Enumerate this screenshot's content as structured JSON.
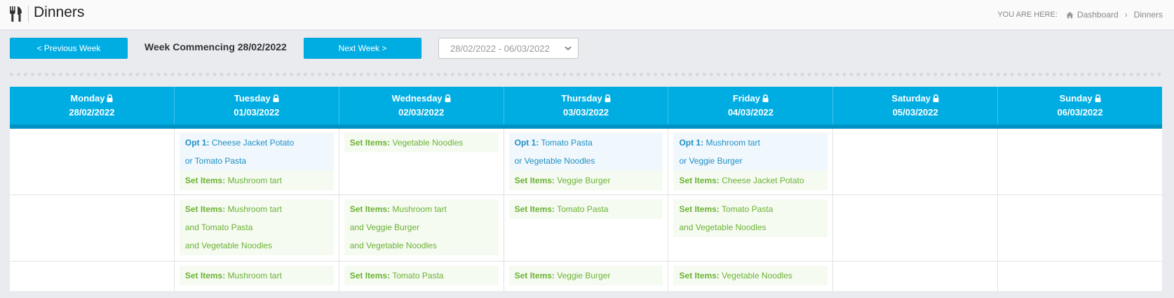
{
  "page": {
    "title": "Dinners",
    "breadcrumb": {
      "prefix": "YOU ARE HERE:",
      "items": [
        "Dashboard",
        "Dinners"
      ]
    }
  },
  "toolbar": {
    "prev_label": "< Previous Week",
    "next_label": "Next Week >",
    "week_label": "Week Commencing 28/02/2022",
    "range_value": "28/02/2022 - 06/03/2022"
  },
  "calendar": {
    "days": [
      {
        "name": "Monday",
        "date": "28/02/2022"
      },
      {
        "name": "Tuesday",
        "date": "01/03/2022"
      },
      {
        "name": "Wednesday",
        "date": "02/03/2022"
      },
      {
        "name": "Thursday",
        "date": "03/03/2022"
      },
      {
        "name": "Friday",
        "date": "04/03/2022"
      },
      {
        "name": "Saturday",
        "date": "05/03/2022"
      },
      {
        "name": "Sunday",
        "date": "06/03/2022"
      }
    ],
    "labels": {
      "option": "Opt 1:",
      "set": "Set Items:"
    },
    "rows": [
      [
        {},
        {
          "option": [
            "Cheese Jacket Potato",
            "or Tomato Pasta"
          ],
          "set": [
            "Mushroom tart"
          ]
        },
        {
          "set": [
            "Vegetable Noodles"
          ]
        },
        {
          "option": [
            "Tomato Pasta",
            "or Vegetable Noodles"
          ],
          "set": [
            "Veggie Burger"
          ]
        },
        {
          "option": [
            "Mushroom tart",
            "or Veggie Burger"
          ],
          "set": [
            "Cheese Jacket Potato"
          ]
        },
        {},
        {}
      ],
      [
        {},
        {
          "set": [
            "Mushroom tart",
            "and Tomato Pasta",
            "and Vegetable Noodles"
          ]
        },
        {
          "set": [
            "Mushroom tart",
            "and Veggie Burger",
            "and Vegetable Noodles"
          ]
        },
        {
          "set": [
            "Tomato Pasta"
          ]
        },
        {
          "set": [
            "Tomato Pasta",
            "and Vegetable Noodles"
          ]
        },
        {},
        {}
      ],
      [
        {},
        {
          "set": [
            "Mushroom tart"
          ]
        },
        {
          "set": [
            "Tomato Pasta"
          ]
        },
        {
          "set": [
            "Veggie Burger"
          ]
        },
        {
          "set": [
            "Vegetable Noodles"
          ]
        },
        {},
        {}
      ]
    ]
  },
  "colors": {
    "accent": "#00ade3",
    "accent_dark": "#0092c3",
    "option_text": "#1f8fc4",
    "set_text": "#6ab133"
  },
  "icons": {
    "page": "cutlery-icon",
    "breadcrumb_home": "home-icon",
    "header_lock": "lock-icon",
    "select": "chevron-down-icon"
  }
}
